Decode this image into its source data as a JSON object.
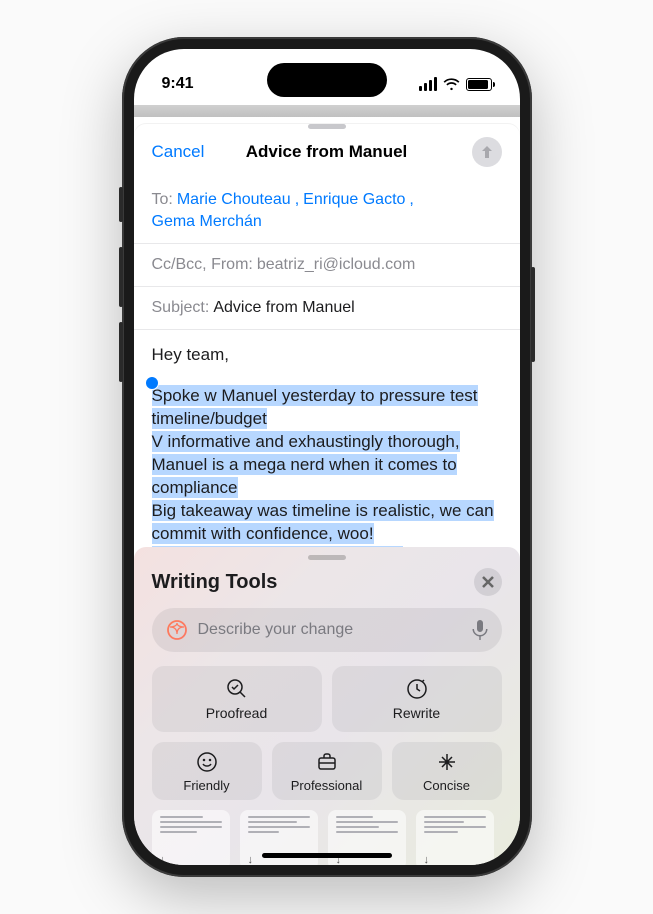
{
  "status": {
    "time": "9:41"
  },
  "nav": {
    "cancel": "Cancel",
    "title": "Advice from Manuel"
  },
  "fields": {
    "to_label": "To:",
    "recipients": [
      "Marie Chouteau",
      "Enrique Gacto",
      "Gema Merchán"
    ],
    "cc_label": "Cc/Bcc, From:",
    "from": "beatriz_ri@icloud.com",
    "subject_label": "Subject:",
    "subject": "Advice from Manuel"
  },
  "body": {
    "greeting": "Hey team,",
    "selected": "Spoke w Manuel yesterday to pressure test timeline/budget\nV informative and exhaustingly thorough, Manuel is a mega nerd when it comes to compliance\nBig takeaway was timeline is realistic, we can commit with confidence, woo!\nM's firm specializes in community consultation, we need help here, should consider engaging"
  },
  "writing_tools": {
    "title": "Writing Tools",
    "describe_placeholder": "Describe your change",
    "buttons": {
      "proofread": "Proofread",
      "rewrite": "Rewrite",
      "friendly": "Friendly",
      "professional": "Professional",
      "concise": "Concise"
    }
  }
}
